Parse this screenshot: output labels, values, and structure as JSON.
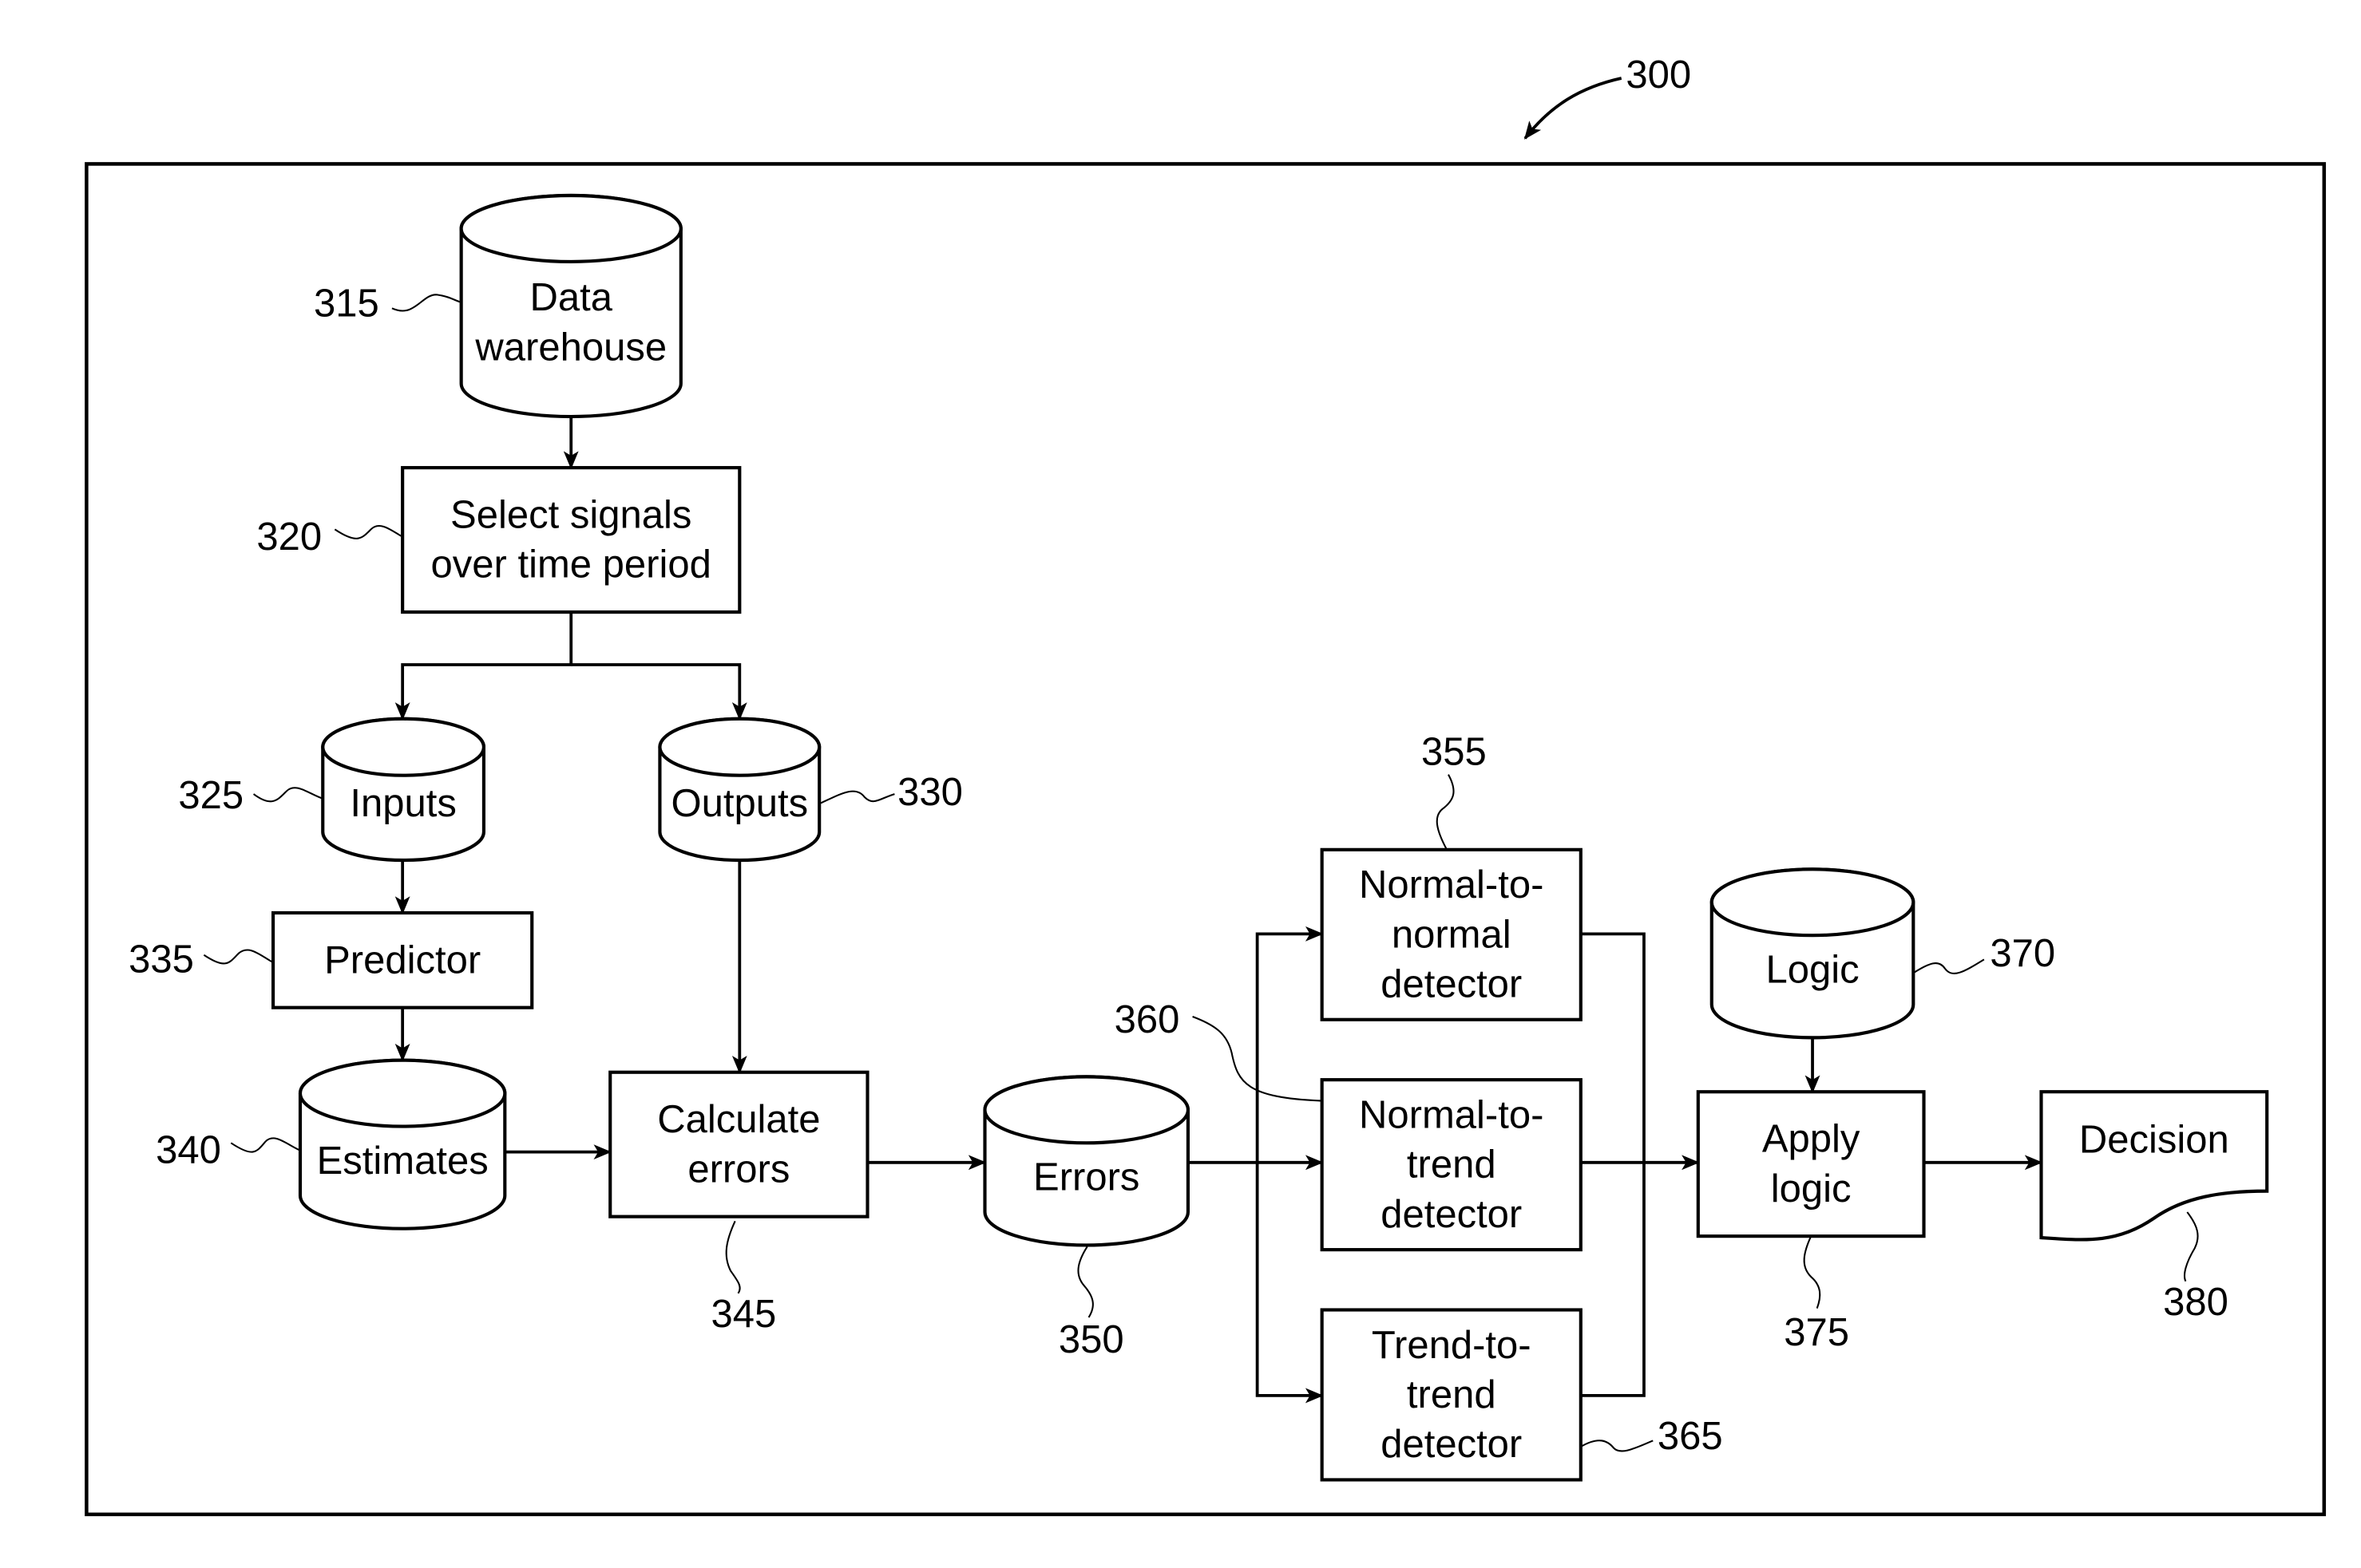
{
  "figure": {
    "reference": "300"
  },
  "nodes": [
    {
      "id": "data-warehouse",
      "type": "database",
      "lines": [
        "Data",
        "warehouse"
      ],
      "ref": "315"
    },
    {
      "id": "select-signals",
      "type": "process",
      "lines": [
        "Select signals",
        "over time period"
      ],
      "ref": "320"
    },
    {
      "id": "inputs",
      "type": "database",
      "lines": [
        "Inputs"
      ],
      "ref": "325"
    },
    {
      "id": "outputs",
      "type": "database",
      "lines": [
        "Outputs"
      ],
      "ref": "330"
    },
    {
      "id": "predictor",
      "type": "process",
      "lines": [
        "Predictor"
      ],
      "ref": "335"
    },
    {
      "id": "estimates",
      "type": "database",
      "lines": [
        "Estimates"
      ],
      "ref": "340"
    },
    {
      "id": "calculate-errors",
      "type": "process",
      "lines": [
        "Calculate",
        "errors"
      ],
      "ref": "345"
    },
    {
      "id": "errors",
      "type": "database",
      "lines": [
        "Errors"
      ],
      "ref": "350"
    },
    {
      "id": "normal-to-normal",
      "type": "process",
      "lines": [
        "Normal-to-",
        "normal",
        "detector"
      ],
      "ref": "355"
    },
    {
      "id": "normal-to-trend",
      "type": "process",
      "lines": [
        "Normal-to-",
        "trend",
        "detector"
      ],
      "ref": "360"
    },
    {
      "id": "trend-to-trend",
      "type": "process",
      "lines": [
        "Trend-to-",
        "trend",
        "detector"
      ],
      "ref": "365"
    },
    {
      "id": "logic",
      "type": "database",
      "lines": [
        "Logic"
      ],
      "ref": "370"
    },
    {
      "id": "apply-logic",
      "type": "process",
      "lines": [
        "Apply",
        "logic"
      ],
      "ref": "375"
    },
    {
      "id": "decision",
      "type": "document",
      "lines": [
        "Decision"
      ],
      "ref": "380"
    }
  ],
  "edges": [
    {
      "from": "data-warehouse",
      "to": "select-signals"
    },
    {
      "from": "select-signals",
      "to": "inputs"
    },
    {
      "from": "select-signals",
      "to": "outputs"
    },
    {
      "from": "inputs",
      "to": "predictor"
    },
    {
      "from": "predictor",
      "to": "estimates"
    },
    {
      "from": "estimates",
      "to": "calculate-errors"
    },
    {
      "from": "outputs",
      "to": "calculate-errors"
    },
    {
      "from": "calculate-errors",
      "to": "errors"
    },
    {
      "from": "errors",
      "to": "normal-to-normal"
    },
    {
      "from": "errors",
      "to": "normal-to-trend"
    },
    {
      "from": "errors",
      "to": "trend-to-trend"
    },
    {
      "from": "normal-to-normal",
      "to": "apply-logic"
    },
    {
      "from": "normal-to-trend",
      "to": "apply-logic"
    },
    {
      "from": "trend-to-trend",
      "to": "apply-logic"
    },
    {
      "from": "logic",
      "to": "apply-logic"
    },
    {
      "from": "apply-logic",
      "to": "decision"
    }
  ]
}
